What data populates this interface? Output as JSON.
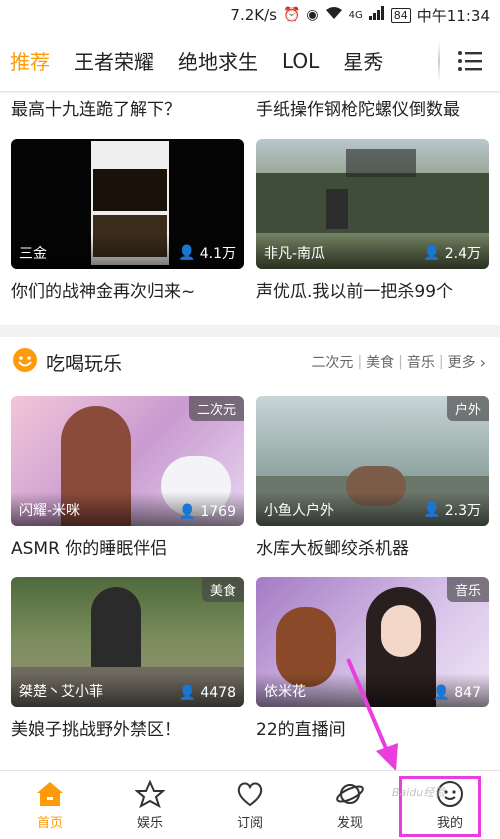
{
  "status_bar": {
    "speed": "7.2K/s",
    "signal": "4G",
    "battery": "84",
    "time": "中午11:34"
  },
  "tabs": [
    {
      "label": "推荐",
      "active": true
    },
    {
      "label": "王者荣耀",
      "active": false
    },
    {
      "label": "绝地求生",
      "active": false
    },
    {
      "label": "LOL",
      "active": false
    },
    {
      "label": "星秀",
      "active": false
    }
  ],
  "top_partial": {
    "left_title": "最高十九连跪了解下？",
    "right_title": "手纸操作钢枪陀螺仪倒数最"
  },
  "feed_cards_1": [
    {
      "uploader": "三金",
      "views": "4.1万",
      "title": "你们的战神金再次归来~"
    },
    {
      "uploader": "非凡-南瓜",
      "views": "2.4万",
      "title": "声优瓜.我以前一把杀99个"
    }
  ],
  "section": {
    "title": "吃喝玩乐",
    "links": [
      "二次元",
      "美食",
      "音乐",
      "更多"
    ]
  },
  "feed_cards_2": [
    {
      "uploader": "闪耀-米咪",
      "views": "1769",
      "category": "二次元",
      "title": "ASMR 你的睡眠伴侣"
    },
    {
      "uploader": "小鱼人户外",
      "views": "2.3万",
      "category": "户外",
      "title": "水库大板鲫绞杀机器"
    },
    {
      "uploader": "桀楚丶艾小菲",
      "views": "4478",
      "category": "美食",
      "title": "美娘子挑战野外禁区！"
    },
    {
      "uploader": "依米花",
      "views": "847",
      "category": "音乐",
      "title": "22的直播间"
    }
  ],
  "bottom_nav": [
    {
      "label": "首页",
      "icon": "home-icon",
      "active": true
    },
    {
      "label": "娱乐",
      "icon": "star-icon",
      "active": false
    },
    {
      "label": "订阅",
      "icon": "heart-icon",
      "active": false
    },
    {
      "label": "发现",
      "icon": "planet-icon",
      "active": false
    },
    {
      "label": "我的",
      "icon": "face-icon",
      "active": false
    }
  ],
  "watermark": "Baidu经验",
  "colors": {
    "accent": "#ff9b0a",
    "highlight": "#e93de0"
  }
}
